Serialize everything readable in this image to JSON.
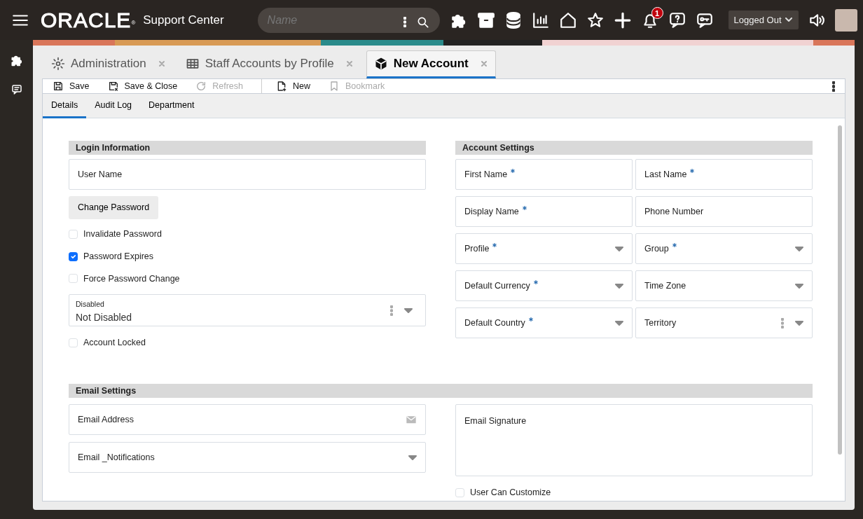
{
  "header": {
    "logo": "ORACLE",
    "logo_mark": "®",
    "app_title": "Support Center",
    "search": {
      "placeholder": "Name"
    },
    "notification_count": "1",
    "status": "Logged Out"
  },
  "document_tabs": [
    {
      "label": "Administration",
      "selected": false
    },
    {
      "label": "Staff Accounts by Profile",
      "selected": false
    },
    {
      "label": "New Account",
      "selected": true
    }
  ],
  "toolbar": [
    [
      {
        "label": "Save",
        "disabled": false
      },
      {
        "label": "Save & Close",
        "disabled": false
      },
      {
        "label": "Refresh",
        "disabled": true
      }
    ],
    [
      {
        "label": "New",
        "disabled": false
      },
      {
        "label": "Bookmark",
        "disabled": true
      }
    ]
  ],
  "sub_tabs": [
    {
      "label": "Details",
      "selected": true
    },
    {
      "label": "Audit Log",
      "selected": false
    },
    {
      "label": "Department",
      "selected": false
    }
  ],
  "login_information": {
    "title": "Login Information",
    "items": [
      {
        "kind": "field",
        "label": "User Name"
      },
      {
        "kind": "button",
        "label": "Change Password"
      },
      {
        "kind": "checkbox",
        "label": "Invalidate Password",
        "checked": false
      },
      {
        "kind": "checkbox",
        "label": "Password Expires",
        "checked": true
      },
      {
        "kind": "checkbox",
        "label": "Force Password Change",
        "checked": false
      },
      {
        "kind": "choice",
        "label": "Disabled",
        "value": "Not Disabled"
      },
      {
        "kind": "checkbox",
        "label": "Account Locked",
        "checked": false
      }
    ]
  },
  "account_settings": {
    "title": "Account Settings",
    "fields": [
      {
        "kind": "text",
        "label": "First Name",
        "required": true
      },
      {
        "kind": "text",
        "label": "Last Name",
        "required": true
      },
      {
        "kind": "text",
        "label": "Display Name",
        "required": true
      },
      {
        "kind": "text",
        "label": "Phone Number",
        "required": false
      },
      {
        "kind": "select",
        "label": "Profile",
        "required": true
      },
      {
        "kind": "select",
        "label": "Group",
        "required": true
      },
      {
        "kind": "select",
        "label": "Default Currency",
        "required": true
      },
      {
        "kind": "select",
        "label": "Time Zone",
        "required": false
      },
      {
        "kind": "select",
        "label": "Default Country",
        "required": true
      },
      {
        "kind": "lookup",
        "label": "Territory",
        "required": false
      }
    ]
  },
  "email_settings": {
    "title": "Email Settings",
    "fields": [
      {
        "kind": "email",
        "label": "Email Address"
      },
      {
        "kind": "select",
        "label": "Email _Notifications"
      }
    ],
    "signature": {
      "label": "Email Signature"
    },
    "customize": {
      "label": "User Can Customize",
      "checked": false
    }
  }
}
